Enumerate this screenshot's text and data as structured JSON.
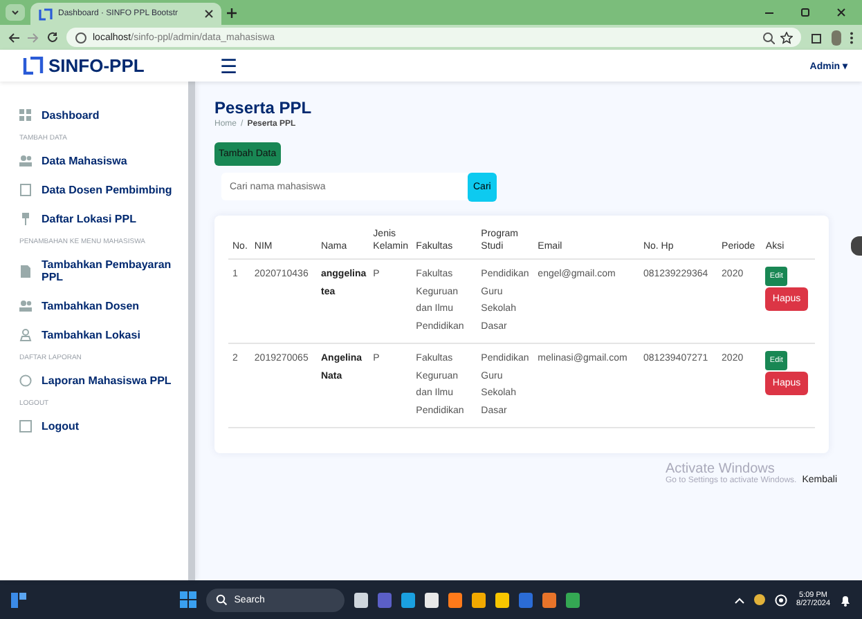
{
  "browser": {
    "tab_title": "Dashboard · SINFO PPL Bootstr",
    "url_host": "localhost",
    "url_path": "/sinfo-ppl/admin/data_mahasiswa"
  },
  "header": {
    "logo": "SINFO-PPL",
    "menu_icon": "☰",
    "user": "Admin ▾"
  },
  "sidebar": [
    {
      "kind": "item",
      "label": "Dashboard"
    },
    {
      "kind": "section",
      "label": "TAMBAH DATA"
    },
    {
      "kind": "item",
      "label": "Data Mahasiswa"
    },
    {
      "kind": "item",
      "label": "Data Dosen Pembimbing"
    },
    {
      "kind": "item",
      "label": "Daftar Lokasi PPL"
    },
    {
      "kind": "section",
      "label": "PENAMBAHAN KE MENU MAHASISWA"
    },
    {
      "kind": "item",
      "label": "Tambahkan Pembayaran PPL"
    },
    {
      "kind": "item",
      "label": "Tambahkan Dosen"
    },
    {
      "kind": "item",
      "label": "Tambahkan Lokasi"
    },
    {
      "kind": "section",
      "label": "DAFTAR LAPORAN"
    },
    {
      "kind": "item",
      "label": "Laporan Mahasiswa PPL"
    },
    {
      "kind": "section",
      "label": "LOGOUT"
    },
    {
      "kind": "item",
      "label": "Logout"
    }
  ],
  "page": {
    "title": "Peserta PPL",
    "breadcrumb": [
      {
        "label": "Home",
        "selected": false
      },
      {
        "label": "Peserta PPL",
        "selected": true
      }
    ],
    "separator": "/",
    "add_button": "Tambah Data",
    "search": {
      "placeholder": "Cari nama mahasiswa",
      "button": "Cari"
    }
  },
  "table": {
    "columns": [
      "No.",
      "NIM",
      "Nama",
      "Jenis Kelamin",
      "Fakultas",
      "Program Studi",
      "Email",
      "No. Hp",
      "Periode",
      "Aksi"
    ],
    "rows": [
      {
        "no": "1",
        "nim": "2020710436",
        "nama": "anggelina tea",
        "jk": "P",
        "fakultas": "Fakultas Keguruan dan Ilmu Pendidikan",
        "prodi": "Pendidikan Guru Sekolah Dasar",
        "email": "engel@gmail.com",
        "hp": "081239229364",
        "periode": "2020",
        "actions": [
          "Edit",
          "Hapus"
        ]
      },
      {
        "no": "2",
        "nim": "2019270065",
        "nama": "Angelina Nata",
        "jk": "P",
        "fakultas": "Fakultas Keguruan dan Ilmu Pendidikan",
        "prodi": "Pendidikan Guru Sekolah Dasar",
        "email": "melinasi@gmail.com",
        "hp": "081239407271",
        "periode": "2020",
        "actions": [
          "Edit",
          "Hapus"
        ]
      }
    ]
  },
  "footer_link": "Kembali",
  "activation_notice": {
    "title": "Activate Windows",
    "text": "Go to Settings to activate Windows."
  },
  "taskbar": {
    "search": "Search",
    "time": "5:09 PM",
    "date": "8/27/2024"
  }
}
